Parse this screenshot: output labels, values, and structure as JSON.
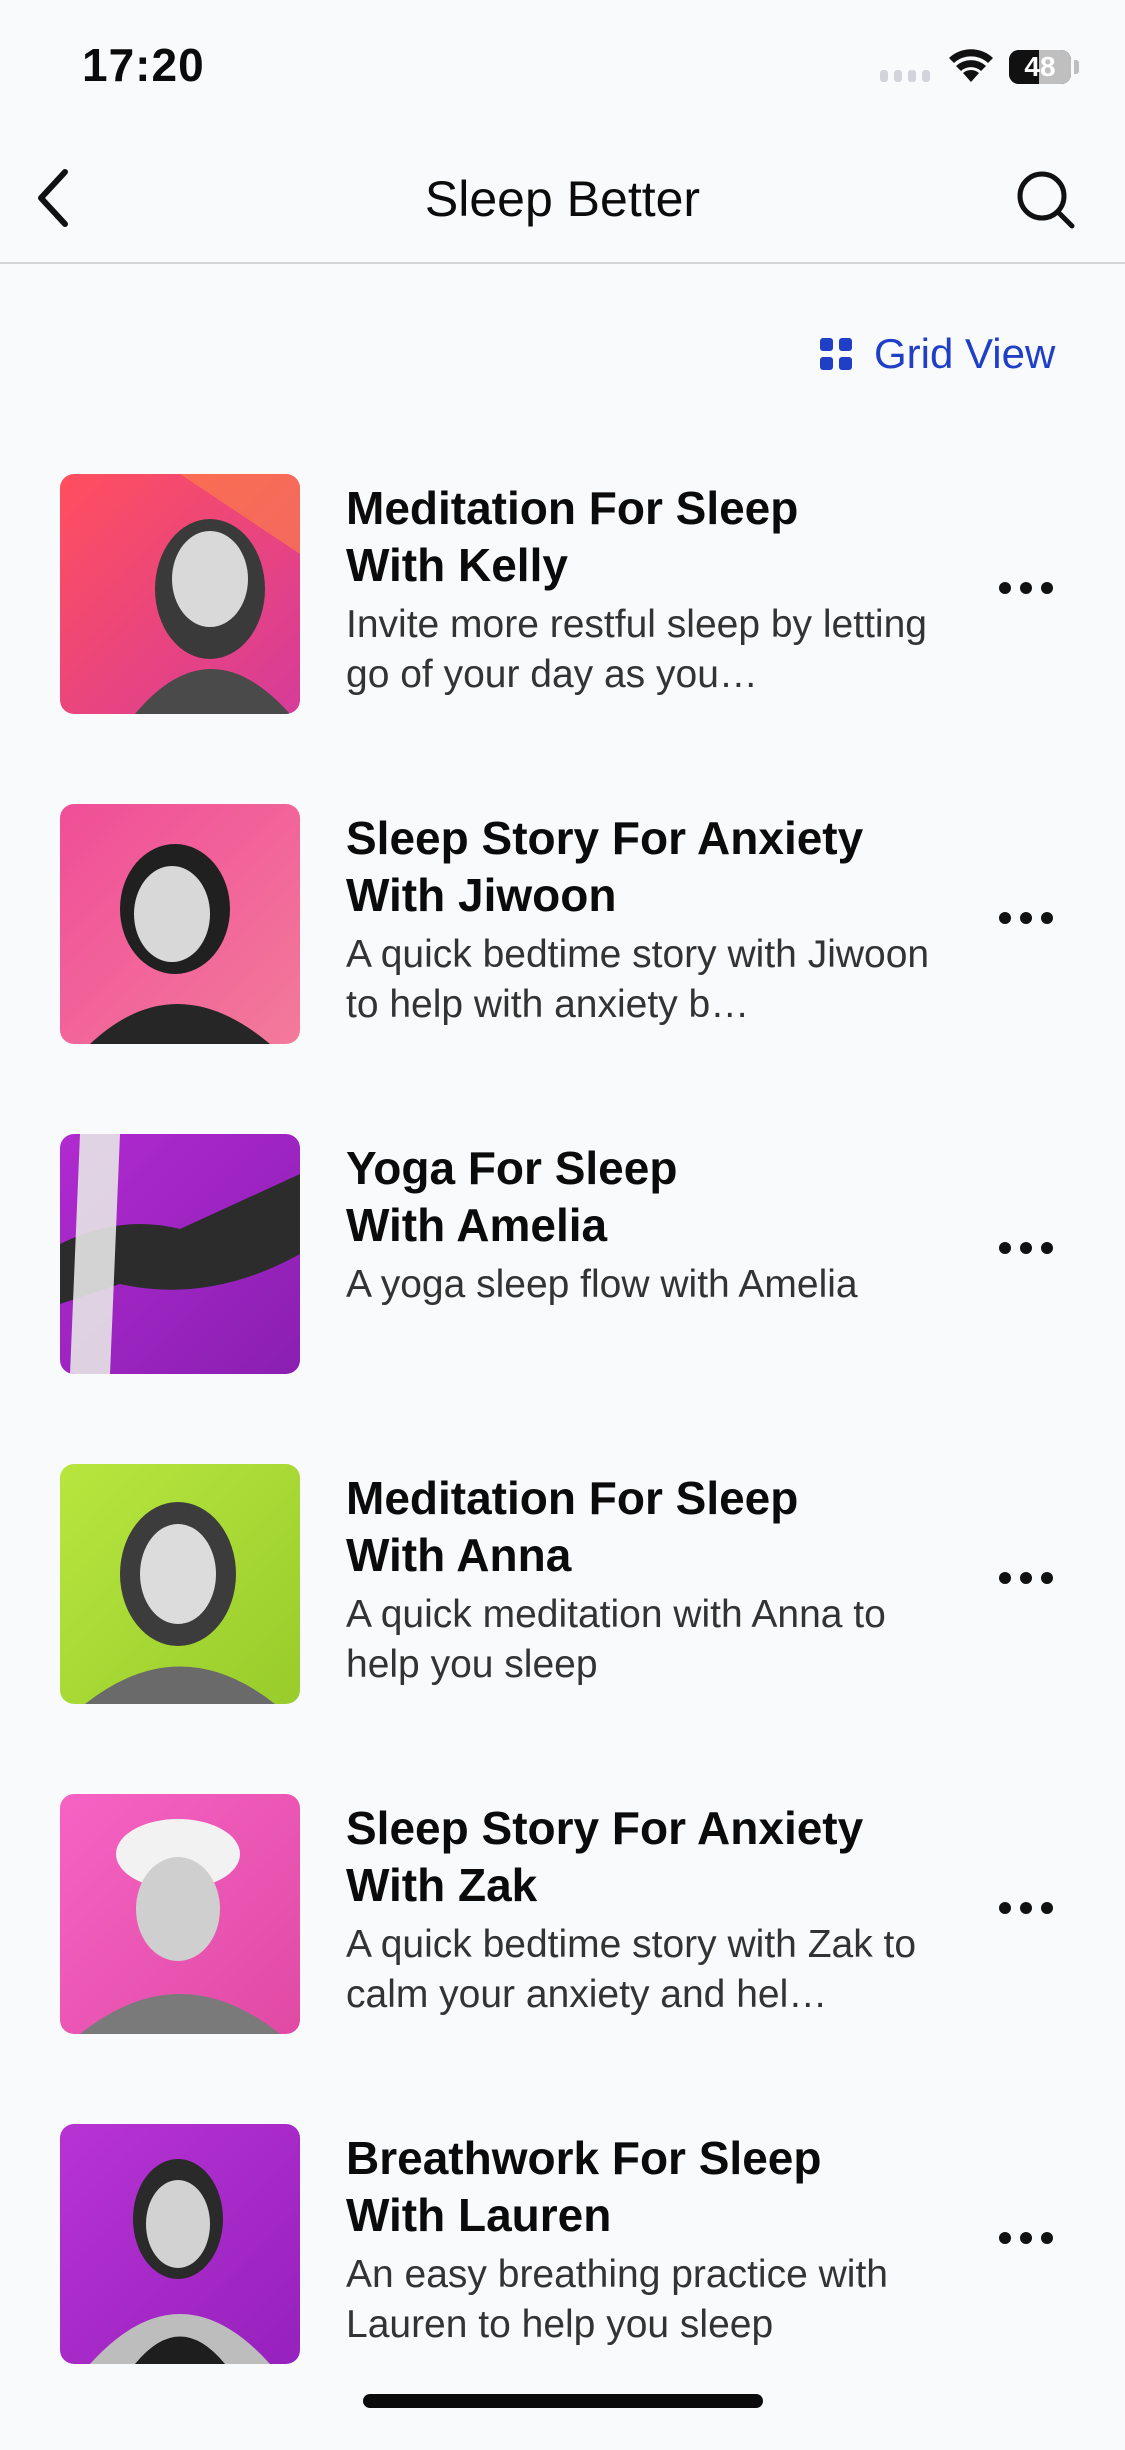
{
  "status_bar": {
    "time": "17:20",
    "battery_level": "48",
    "battery_fraction": 0.48
  },
  "nav": {
    "title": "Sleep Better",
    "back_icon": "chevron-left-icon",
    "search_icon": "search-icon"
  },
  "view_toggle": {
    "label": "Grid View",
    "icon": "grid-icon",
    "color": "#1f3fc7"
  },
  "sessions": [
    {
      "title": "Meditation For Sleep\nWith Kelly",
      "description": "Invite more restful sleep by letting go of your day as you…",
      "thumb_colors": [
        "#ff4f6d",
        "#e0428a"
      ]
    },
    {
      "title": "Sleep Story For Anxiety\nWith Jiwoon",
      "description": "A quick bedtime story with Jiwoon to help with anxiety b…",
      "thumb_colors": [
        "#f4508f",
        "#ec6f9e"
      ]
    },
    {
      "title": "Yoga For Sleep\nWith Amelia",
      "description": "A yoga sleep flow with Amelia",
      "thumb_colors": [
        "#a623c4",
        "#8e1fb5"
      ]
    },
    {
      "title": "Meditation For Sleep\nWith Anna",
      "description": "A quick meditation with Anna to help you sleep",
      "thumb_colors": [
        "#b3e23c",
        "#9fd22e"
      ]
    },
    {
      "title": "Sleep Story For Anxiety\nWith Zak",
      "description": "A quick bedtime story with Zak to calm your anxiety and hel…",
      "thumb_colors": [
        "#f45ec0",
        "#e44aa8"
      ]
    },
    {
      "title": "Breathwork For Sleep\nWith Lauren",
      "description": "An easy breathing practice with Lauren to help you sleep",
      "thumb_colors": [
        "#b12fcf",
        "#9a22c0"
      ]
    }
  ]
}
